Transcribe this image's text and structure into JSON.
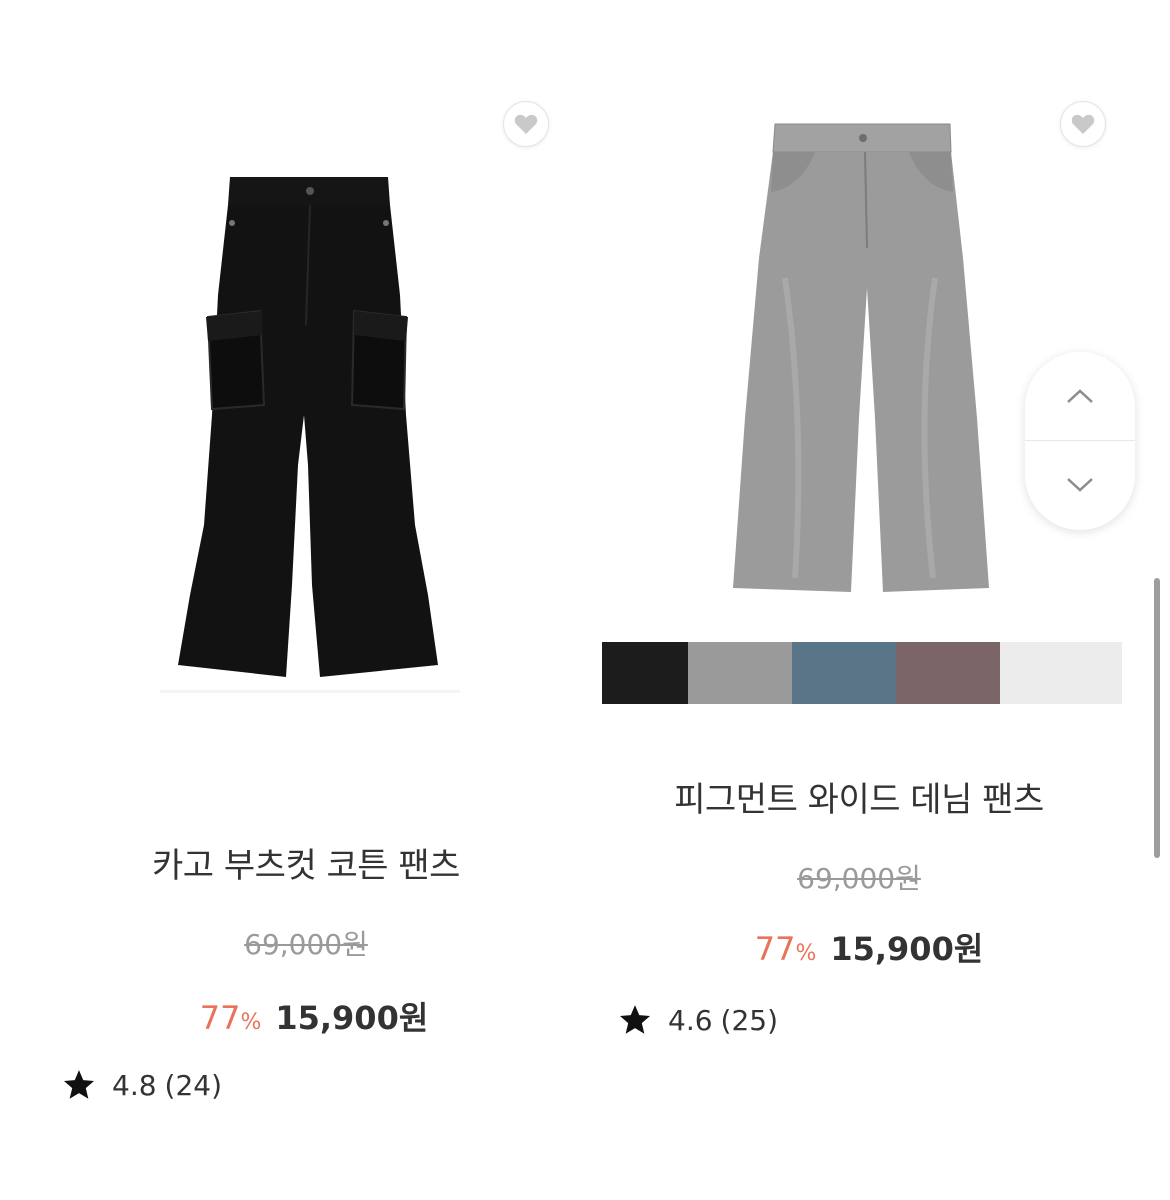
{
  "products": [
    {
      "name": "카고 부츠컷 코튼 팬츠",
      "original_price": "69,000원",
      "discount": "77",
      "discount_unit": "%",
      "sale_price": "15,900원",
      "rating": "4.8",
      "review_count": "(24)",
      "image_icon": "black-flare-cargo-pants-image",
      "wishlist_icon": "heart-icon"
    },
    {
      "name": "피그먼트 와이드 데님 팬츠",
      "original_price": "69,000원",
      "discount": "77",
      "discount_unit": "%",
      "sale_price": "15,900원",
      "rating": "4.6",
      "review_count": "(25)",
      "image_icon": "grey-wide-denim-pants-image",
      "wishlist_icon": "heart-icon",
      "color_swatches": [
        "#1c1c1c",
        "#9a9a9a",
        "#5a7488",
        "#7b6566",
        "#ececec"
      ]
    }
  ],
  "scroll_controls": {
    "up_icon": "chevron-up-icon",
    "down_icon": "chevron-down-icon"
  },
  "colors": {
    "discount": "#e8735a",
    "price": "#333333",
    "strike": "#9a9a9a",
    "black_pants": "#121212",
    "grey_denim": "#9b9b9b"
  }
}
